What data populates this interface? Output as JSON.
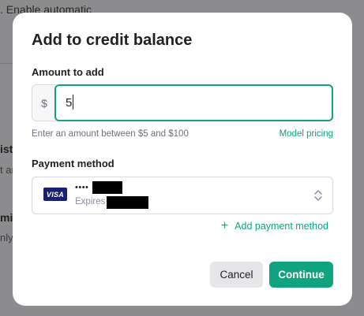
{
  "background": {
    "top_text": ". Enable automatic",
    "side_heading": "ist",
    "side_snippet_1": "t ar",
    "side_heading_2": "mi",
    "side_snippet_2": "nly"
  },
  "dialog": {
    "title": "Add to credit balance",
    "amount": {
      "label": "Amount to add",
      "currency_symbol": "$",
      "value": "5",
      "hint": "Enter an amount between $5 and $100",
      "pricing_link": "Model pricing"
    },
    "payment": {
      "label": "Payment method",
      "card_brand": "VISA",
      "card_masked": "••••",
      "expires_label": "Expires",
      "add_method_label": "Add payment method",
      "add_icon": "plus-icon",
      "select_icon": "chevron-updown-icon"
    },
    "buttons": {
      "cancel": "Cancel",
      "continue": "Continue"
    }
  },
  "colors": {
    "accent": "#10a37f",
    "overlay": "#8c8c8e",
    "visa": "#1a1f71"
  }
}
